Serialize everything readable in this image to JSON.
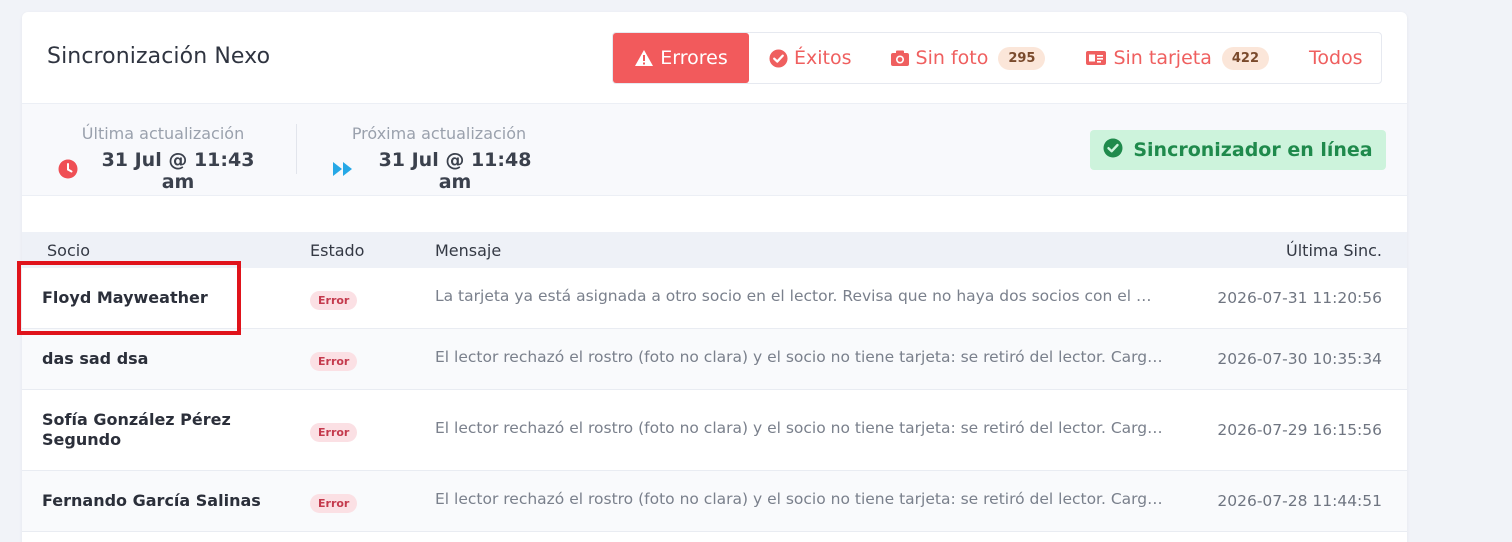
{
  "header": {
    "title": "Sincronización Nexo"
  },
  "filters": [
    {
      "label": "Errores",
      "icon": "warning-icon",
      "active": true
    },
    {
      "label": "Éxitos",
      "icon": "check-circle-icon",
      "active": false
    },
    {
      "label": "Sin foto",
      "icon": "camera-icon",
      "count": "295",
      "active": false
    },
    {
      "label": "Sin tarjeta",
      "icon": "id-card-icon",
      "count": "422",
      "active": false
    },
    {
      "label": "Todos",
      "icon": "",
      "active": false
    }
  ],
  "sync": {
    "last_label": "Última actualización",
    "last_value": "31 Jul @ 11:43 am",
    "next_label": "Próxima actualización",
    "next_value": "31 Jul @ 11:48 am",
    "status": "Sincronizador en línea"
  },
  "table": {
    "columns": {
      "socio": "Socio",
      "estado": "Estado",
      "mensaje": "Mensaje",
      "ultima": "Última Sinc."
    },
    "rows": [
      {
        "socio": "Floyd Mayweather",
        "estado": "Error",
        "mensaje": "La tarjeta ya está asignada a otro socio en el lector. Revisa que no haya dos socios con el mismo número de tarjeta.",
        "fecha": "2026-07-31 11:20:56"
      },
      {
        "socio": "das sad dsa",
        "estado": "Error",
        "mensaje": "El lector rechazó el rostro (foto no clara) y el socio no tiene tarjeta: se retiró del lector. Cargue una foto nueva.",
        "fecha": "2026-07-30 10:35:34"
      },
      {
        "socio": "Sofía González Pérez Segundo",
        "estado": "Error",
        "mensaje": "El lector rechazó el rostro (foto no clara) y el socio no tiene tarjeta: se retiró del lector. Cargue una foto nueva.",
        "fecha": "2026-07-29 16:15:56"
      },
      {
        "socio": "Fernando García Salinas",
        "estado": "Error",
        "mensaje": "El lector rechazó el rostro (foto no clara) y el socio no tiene tarjeta: se retiró del lector. Cargue una foto nueva.",
        "fecha": "2026-07-28 11:44:51"
      }
    ]
  },
  "colors": {
    "accent": "#f25a5c",
    "success_bg": "#cdf3dc",
    "success_text": "#1f8a4c",
    "highlight": "#e0131b"
  }
}
